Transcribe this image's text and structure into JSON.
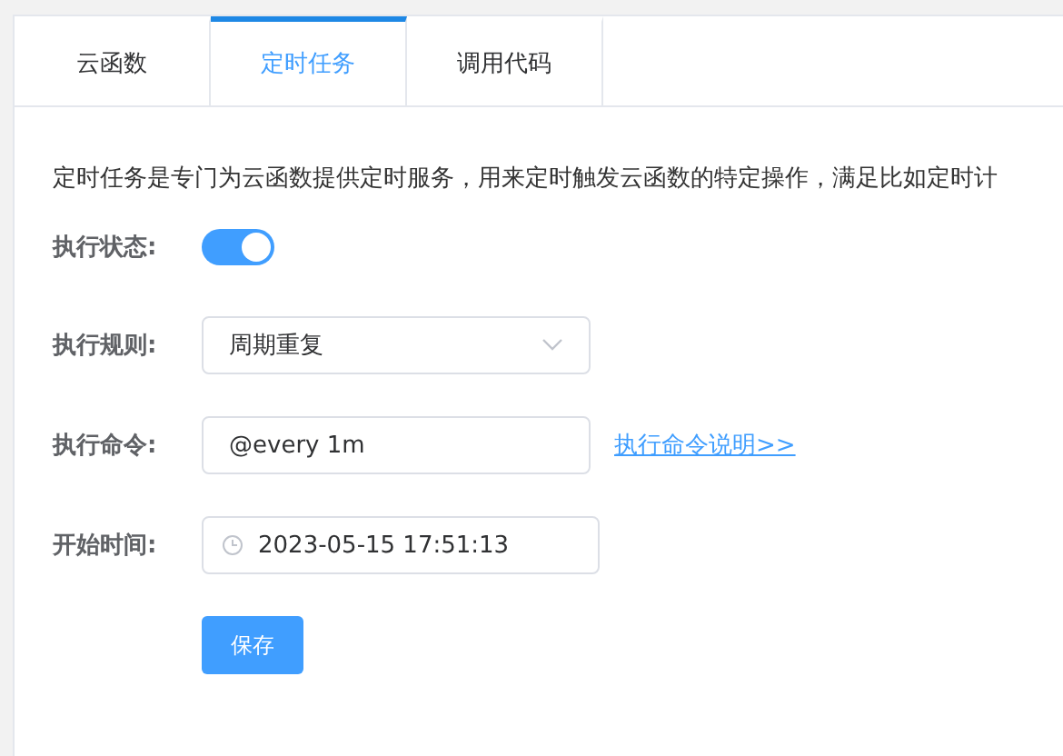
{
  "tabs": [
    {
      "label": "云函数",
      "selected": false
    },
    {
      "label": "定时任务",
      "selected": true
    },
    {
      "label": "调用代码",
      "selected": false
    }
  ],
  "description": "定时任务是专门为云函数提供定时服务，用来定时触发云函数的特定操作，满足比如定时计",
  "fields": [
    {
      "kind": "switch",
      "label": "执行状态:",
      "on": true
    },
    {
      "kind": "select",
      "label": "执行规则:",
      "value": "周期重复"
    },
    {
      "kind": "input",
      "label": "执行命令:",
      "value": "@every 1m",
      "link": "执行命令说明>>"
    },
    {
      "kind": "datetime",
      "label": "开始时间:",
      "value": "2023-05-15 17:51:13"
    }
  ],
  "save_button": "保存"
}
